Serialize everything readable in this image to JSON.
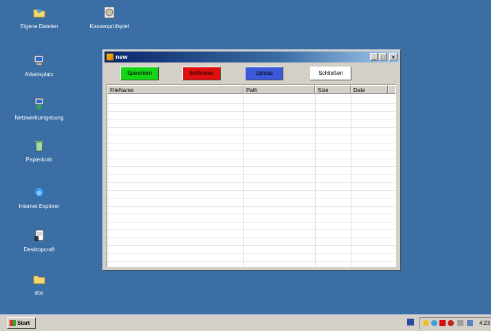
{
  "desktop": {
    "background": "#3a6ea5",
    "icons": [
      {
        "label": "Eigene Dateien",
        "icon": "folder-icon"
      },
      {
        "label": "Kassenprüfspiel",
        "icon": "cd-icon"
      },
      {
        "label": "Arbeitsplatz",
        "icon": "computer-icon"
      },
      {
        "label": "Netzwerkumgebung",
        "icon": "network-icon"
      },
      {
        "label": "Papierkorb",
        "icon": "recycle-bin-icon"
      },
      {
        "label": "Internet Explorer",
        "icon": "ie-icon"
      },
      {
        "label": "Desktopcraft",
        "icon": "document-icon"
      },
      {
        "label": "doc",
        "icon": "folder-icon"
      }
    ]
  },
  "window": {
    "title": "new",
    "controls": {
      "minimize": "_",
      "maximize": "□",
      "close": "×"
    },
    "buttons": [
      {
        "label": "Speichern",
        "color": "#16d416"
      },
      {
        "label": "Entfernen",
        "color": "#e01010"
      },
      {
        "label": "Upload",
        "color": "#3c5ad8"
      },
      {
        "label": "Schließen",
        "color": "#ffffff"
      }
    ],
    "columns": [
      "FileName",
      "Path",
      "Size",
      "Date"
    ],
    "rows": []
  },
  "taskbar": {
    "start_label": "Start",
    "clock": "4:23"
  }
}
